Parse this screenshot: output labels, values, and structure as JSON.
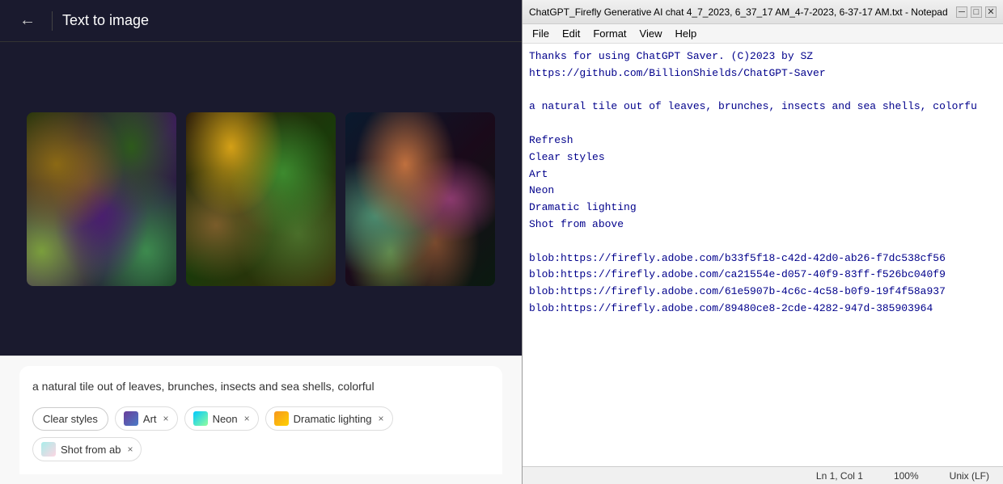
{
  "firefly": {
    "header": {
      "back_icon": "←",
      "title": "Text to image"
    },
    "prompt": {
      "text": "a natural tile out of leaves, brunches, insects and sea shells, colorful"
    },
    "style_tags": {
      "clear_label": "Clear styles",
      "tags": [
        {
          "id": "art",
          "label": "Art",
          "icon_type": "art",
          "close": "×"
        },
        {
          "id": "neon",
          "label": "Neon",
          "icon_type": "neon",
          "close": "×"
        },
        {
          "id": "dramatic",
          "label": "Dramatic lighting",
          "icon_type": "dramatic",
          "close": "×"
        },
        {
          "id": "shot",
          "label": "Shot from ab",
          "icon_type": "shot",
          "close": "×"
        }
      ]
    }
  },
  "notepad": {
    "title": "ChatGPT_Firefly Generative AI chat 4_7_2023, 6_37_17 AM_4-7-2023, 6-37-17 AM.txt - Notepad",
    "menu": {
      "items": [
        "File",
        "Edit",
        "Format",
        "View",
        "Help"
      ]
    },
    "content": "Thanks for using ChatGPT Saver. (C)2023 by SZ\nhttps://github.com/BillionShields/ChatGPT-Saver\n\na natural tile out of leaves, brunches, insects and sea shells, colorfu\n\nRefresh\nClear styles\nArt\nNeon\nDramatic lighting\nShot from above\n\nblob:https://firefly.adobe.com/b33f5f18-c42d-42d0-ab26-f7dc538cf56\nblob:https://firefly.adobe.com/ca21554e-d057-40f9-83ff-f526bc040f9\nblob:https://firefly.adobe.com/61e5907b-4c6c-4c58-b0f9-19f4f58a937\nblob:https://firefly.adobe.com/89480ce8-2cde-4282-947d-385903964",
    "statusbar": {
      "position": "Ln 1, Col 1",
      "zoom": "100%",
      "encoding": "Unix (LF)"
    }
  }
}
